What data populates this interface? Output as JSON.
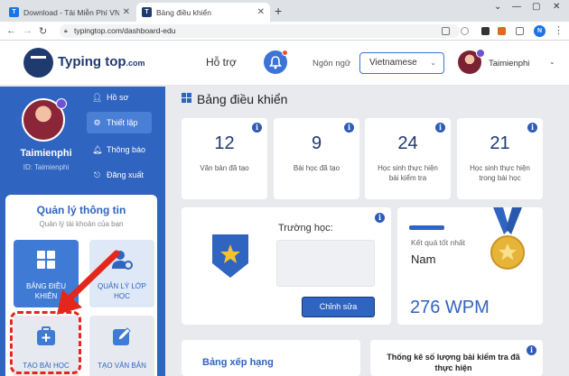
{
  "browser": {
    "tabs": [
      {
        "title": "Download - Tải Miễn Phí VN - Ph",
        "active": false
      },
      {
        "title": "Bảng điều khiển",
        "active": true
      }
    ],
    "url": "typingtop.com/dashboard-edu",
    "profile_initial": "N"
  },
  "header": {
    "logo_text": "Typing top",
    "logo_domain": ".com",
    "help": "Hỗ trợ",
    "language_label": "Ngôn ngữ",
    "language_value": "Vietnamese",
    "user_name": "Taimienphi"
  },
  "sidebar": {
    "profile_name": "Taimienphi",
    "profile_id": "ID: Taimienphi",
    "menu": [
      {
        "label": "Hồ sơ",
        "icon": "user-icon"
      },
      {
        "label": "Thiết lập",
        "icon": "gear-icon"
      },
      {
        "label": "Thông báo",
        "icon": "bell-icon"
      },
      {
        "label": "Đăng xuất",
        "icon": "logout-icon"
      }
    ],
    "management": {
      "title": "Quản lý thông tin",
      "subtitle": "Quản lý tài khoản của bạn",
      "tiles": [
        {
          "label_line1": "BẢNG ĐIỀU",
          "label_line2": "KHIỂN",
          "icon": "grid-icon"
        },
        {
          "label_line1": "QUẢN LÝ LỚP",
          "label_line2": "HỌC",
          "icon": "class-settings-icon"
        },
        {
          "label_line1": "TẠO BÀI HỌC",
          "label_line2": "",
          "icon": "add-lesson-icon"
        },
        {
          "label_line1": "TẠO VĂN BẢN",
          "label_line2": "",
          "icon": "edit-text-icon"
        }
      ]
    }
  },
  "main": {
    "title": "Bảng điều khiển",
    "stats": [
      {
        "value": "12",
        "label_line1": "Văn bản đã tạo",
        "label_line2": ""
      },
      {
        "value": "9",
        "label_line1": "Bài học đã tạo",
        "label_line2": ""
      },
      {
        "value": "24",
        "label_line1": "Học sinh thực hiện",
        "label_line2": "bài kiểm tra"
      },
      {
        "value": "21",
        "label_line1": "Học sinh thực hiện",
        "label_line2": "trong bài học"
      }
    ],
    "school_label": "Trường học:",
    "edit_button": "Chỉnh sửa",
    "best_result_label": "Kết quả tốt nhất",
    "best_result_name": "Nam",
    "best_result_wpm": "276 WPM",
    "ranking_title": "Bảng xếp hạng",
    "tests_title_line1": "Thống kê số lượng bài kiểm tra đã",
    "tests_title_line2": "thực hiện"
  },
  "colors": {
    "primary": "#2f64c0",
    "highlight": "#e3271b",
    "medal_gold": "#e7b43a"
  }
}
